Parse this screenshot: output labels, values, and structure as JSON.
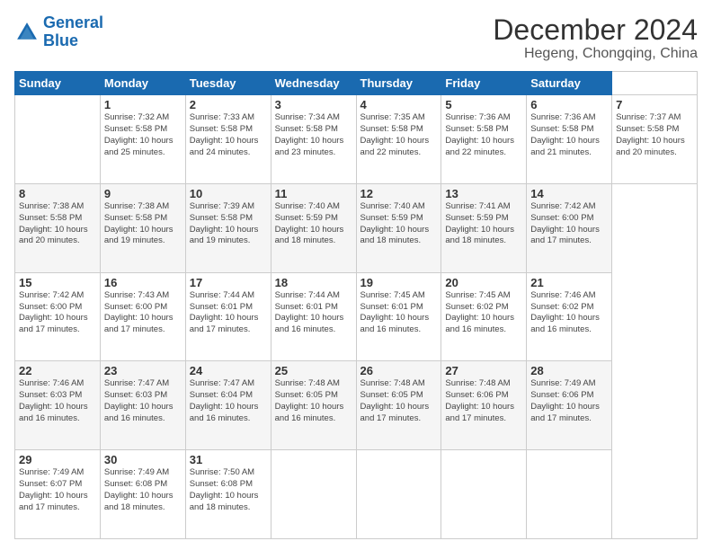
{
  "header": {
    "logo_general": "General",
    "logo_blue": "Blue",
    "title": "December 2024",
    "subtitle": "Hegeng, Chongqing, China"
  },
  "calendar": {
    "days_of_week": [
      "Sunday",
      "Monday",
      "Tuesday",
      "Wednesday",
      "Thursday",
      "Friday",
      "Saturday"
    ],
    "weeks": [
      [
        null,
        {
          "day": "1",
          "sunrise": "7:32 AM",
          "sunset": "5:58 PM",
          "daylight": "10 hours and 25 minutes."
        },
        {
          "day": "2",
          "sunrise": "7:33 AM",
          "sunset": "5:58 PM",
          "daylight": "10 hours and 24 minutes."
        },
        {
          "day": "3",
          "sunrise": "7:34 AM",
          "sunset": "5:58 PM",
          "daylight": "10 hours and 23 minutes."
        },
        {
          "day": "4",
          "sunrise": "7:35 AM",
          "sunset": "5:58 PM",
          "daylight": "10 hours and 22 minutes."
        },
        {
          "day": "5",
          "sunrise": "7:36 AM",
          "sunset": "5:58 PM",
          "daylight": "10 hours and 22 minutes."
        },
        {
          "day": "6",
          "sunrise": "7:36 AM",
          "sunset": "5:58 PM",
          "daylight": "10 hours and 21 minutes."
        },
        {
          "day": "7",
          "sunrise": "7:37 AM",
          "sunset": "5:58 PM",
          "daylight": "10 hours and 20 minutes."
        }
      ],
      [
        {
          "day": "8",
          "sunrise": "7:38 AM",
          "sunset": "5:58 PM",
          "daylight": "10 hours and 20 minutes."
        },
        {
          "day": "9",
          "sunrise": "7:38 AM",
          "sunset": "5:58 PM",
          "daylight": "10 hours and 19 minutes."
        },
        {
          "day": "10",
          "sunrise": "7:39 AM",
          "sunset": "5:58 PM",
          "daylight": "10 hours and 19 minutes."
        },
        {
          "day": "11",
          "sunrise": "7:40 AM",
          "sunset": "5:59 PM",
          "daylight": "10 hours and 18 minutes."
        },
        {
          "day": "12",
          "sunrise": "7:40 AM",
          "sunset": "5:59 PM",
          "daylight": "10 hours and 18 minutes."
        },
        {
          "day": "13",
          "sunrise": "7:41 AM",
          "sunset": "5:59 PM",
          "daylight": "10 hours and 18 minutes."
        },
        {
          "day": "14",
          "sunrise": "7:42 AM",
          "sunset": "6:00 PM",
          "daylight": "10 hours and 17 minutes."
        }
      ],
      [
        {
          "day": "15",
          "sunrise": "7:42 AM",
          "sunset": "6:00 PM",
          "daylight": "10 hours and 17 minutes."
        },
        {
          "day": "16",
          "sunrise": "7:43 AM",
          "sunset": "6:00 PM",
          "daylight": "10 hours and 17 minutes."
        },
        {
          "day": "17",
          "sunrise": "7:44 AM",
          "sunset": "6:01 PM",
          "daylight": "10 hours and 17 minutes."
        },
        {
          "day": "18",
          "sunrise": "7:44 AM",
          "sunset": "6:01 PM",
          "daylight": "10 hours and 16 minutes."
        },
        {
          "day": "19",
          "sunrise": "7:45 AM",
          "sunset": "6:01 PM",
          "daylight": "10 hours and 16 minutes."
        },
        {
          "day": "20",
          "sunrise": "7:45 AM",
          "sunset": "6:02 PM",
          "daylight": "10 hours and 16 minutes."
        },
        {
          "day": "21",
          "sunrise": "7:46 AM",
          "sunset": "6:02 PM",
          "daylight": "10 hours and 16 minutes."
        }
      ],
      [
        {
          "day": "22",
          "sunrise": "7:46 AM",
          "sunset": "6:03 PM",
          "daylight": "10 hours and 16 minutes."
        },
        {
          "day": "23",
          "sunrise": "7:47 AM",
          "sunset": "6:03 PM",
          "daylight": "10 hours and 16 minutes."
        },
        {
          "day": "24",
          "sunrise": "7:47 AM",
          "sunset": "6:04 PM",
          "daylight": "10 hours and 16 minutes."
        },
        {
          "day": "25",
          "sunrise": "7:48 AM",
          "sunset": "6:05 PM",
          "daylight": "10 hours and 16 minutes."
        },
        {
          "day": "26",
          "sunrise": "7:48 AM",
          "sunset": "6:05 PM",
          "daylight": "10 hours and 17 minutes."
        },
        {
          "day": "27",
          "sunrise": "7:48 AM",
          "sunset": "6:06 PM",
          "daylight": "10 hours and 17 minutes."
        },
        {
          "day": "28",
          "sunrise": "7:49 AM",
          "sunset": "6:06 PM",
          "daylight": "10 hours and 17 minutes."
        }
      ],
      [
        {
          "day": "29",
          "sunrise": "7:49 AM",
          "sunset": "6:07 PM",
          "daylight": "10 hours and 17 minutes."
        },
        {
          "day": "30",
          "sunrise": "7:49 AM",
          "sunset": "6:08 PM",
          "daylight": "10 hours and 18 minutes."
        },
        {
          "day": "31",
          "sunrise": "7:50 AM",
          "sunset": "6:08 PM",
          "daylight": "10 hours and 18 minutes."
        },
        null,
        null,
        null,
        null
      ]
    ]
  }
}
